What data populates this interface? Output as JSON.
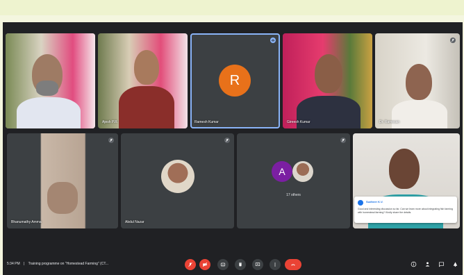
{
  "tiles": [
    {
      "name": "",
      "mic_muted": false
    },
    {
      "name": "Ajesh P.R.",
      "mic_muted": false
    },
    {
      "name": "Ramesh Kumar",
      "mic_muted": false,
      "avatar_letter": "R",
      "avatar_color": "#e8711a"
    },
    {
      "name": "Gireesh Kumar",
      "mic_muted": false
    },
    {
      "name": "Dr. Ramesan",
      "mic_muted": true
    },
    {
      "name": "Bhanumathy Amma",
      "mic_muted": true
    },
    {
      "name": "Abdul Nazar",
      "mic_muted": true
    },
    {
      "name": "",
      "mic_muted": true,
      "avatar_letter": "A",
      "avatar_color": "#7b1fa2",
      "others_label": "17 others"
    },
    {
      "name": "",
      "mic_muted": false
    }
  ],
  "chat_notification": {
    "sender": "Sudheer K.V.",
    "message": "Good and interesting discussion so far. Can we learn more about integrating fish farming with homestead farming? Kindly share the details."
  },
  "bottom_bar": {
    "time": "5:34 PM",
    "separator": "|",
    "meeting_title": "Training programme on \"Homestead Farming\" (CT..."
  },
  "colors": {
    "meet_bg": "#202124",
    "tile_bg": "#3c4043",
    "accent_blue": "#8ab4f8",
    "danger_red": "#ea4335",
    "page_bg": "#f4f6df"
  }
}
